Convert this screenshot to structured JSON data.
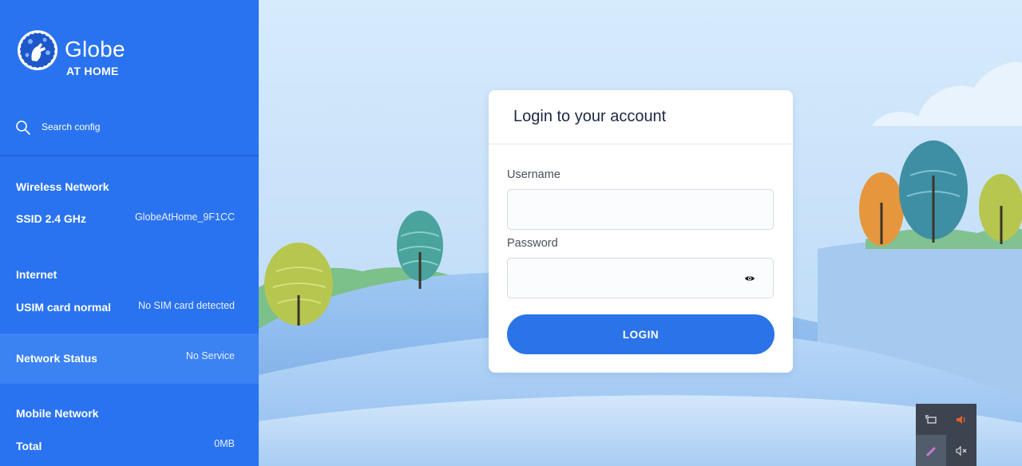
{
  "brand": {
    "name": "Globe",
    "tagline": "AT HOME"
  },
  "search": {
    "label": "Search config",
    "icon": "search-icon"
  },
  "sidebar": {
    "wireless": {
      "title": "Wireless Network",
      "ssid_label": "SSID 2.4 GHz",
      "ssid_value": "GlobeAtHome_9F1CC"
    },
    "internet": {
      "title": "Internet",
      "usim_label": "USIM card normal",
      "usim_value": "No SIM card detected"
    },
    "network_status": {
      "label": "Network Status",
      "value": "No Service"
    },
    "mobile": {
      "title": "Mobile Network",
      "total_label": "Total",
      "total_value": "0MB"
    }
  },
  "login": {
    "title": "Login to your account",
    "username_label": "Username",
    "username_value": "",
    "password_label": "Password",
    "password_value": "",
    "button_label": "LOGIN",
    "password_toggle_icon": "eye-icon"
  },
  "tray": {
    "icons": [
      "network-adapter-icon",
      "speaker-icon",
      "pen-icon",
      "mute-icon"
    ]
  },
  "colors": {
    "sidebar": "#2a73f0",
    "status_band": "#3b82f3",
    "button": "#2a73e8",
    "title_text": "#1b2a43"
  }
}
